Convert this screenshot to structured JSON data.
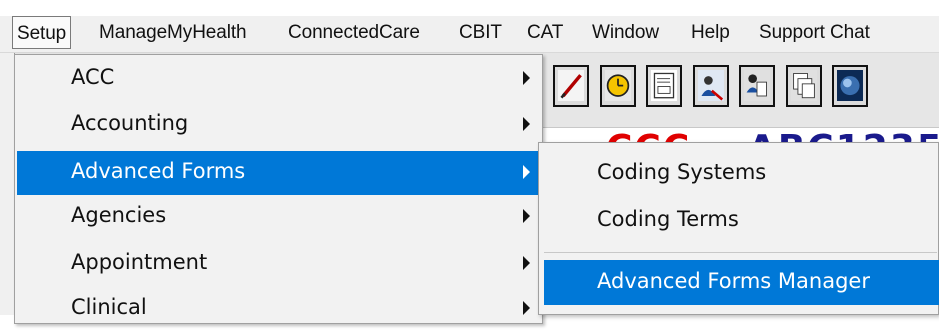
{
  "menubar": {
    "items": [
      {
        "label": "Setup",
        "active": true
      },
      {
        "label": "ManageMyHealth"
      },
      {
        "label": "ConnectedCare"
      },
      {
        "label": "CBIT"
      },
      {
        "label": "CAT"
      },
      {
        "label": "Window"
      },
      {
        "label": "Help"
      },
      {
        "label": "Support Chat"
      }
    ]
  },
  "toolbar": {
    "buttons": [
      "pen-icon",
      "clock-icon",
      "form-icon",
      "person-icon",
      "document-icon",
      "windows-icon",
      "globe-icon"
    ]
  },
  "setup_menu": {
    "items": [
      {
        "label": "ACC",
        "has_submenu": true
      },
      {
        "label": "Accounting",
        "has_submenu": true
      },
      {
        "label": "Advanced Forms",
        "has_submenu": true,
        "selected": true
      },
      {
        "label": "Agencies",
        "has_submenu": true
      },
      {
        "label": "Appointment",
        "has_submenu": true
      },
      {
        "label": "Clinical",
        "has_submenu": true
      }
    ]
  },
  "advanced_forms_submenu": {
    "items": [
      {
        "label": "Coding Systems"
      },
      {
        "label": "Coding Terms"
      },
      {
        "label": "Advanced Forms Manager",
        "selected": true
      }
    ]
  },
  "colors": {
    "selection": "#0078d7",
    "menu_bg": "#f2f2f2",
    "background_code_red": "#e00000",
    "background_code_blue": "#1a1a8c"
  }
}
